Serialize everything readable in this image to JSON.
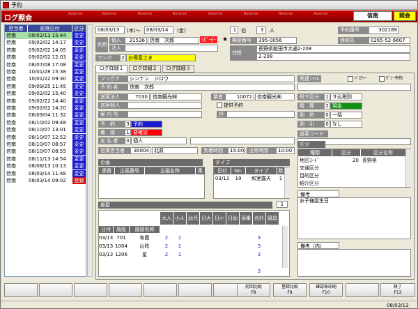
{
  "window": {
    "title": "予約"
  },
  "header": {
    "title": "ログ照会",
    "reserve": "Reserve",
    "right1": "信南",
    "right2": "照会"
  },
  "list": {
    "headers": [
      "担当者",
      "処理日付",
      "区分"
    ],
    "rows": [
      {
        "tanto": "信南",
        "date": "09/02/13 15:44",
        "kubun": "変更",
        "color": "#1a1ad0",
        "sel": true
      },
      {
        "tanto": "信南",
        "date": "09/02/02 14:17",
        "kubun": "変更",
        "color": "#1a1ad0"
      },
      {
        "tanto": "信南",
        "date": "09/02/02 14:05",
        "kubun": "変更",
        "color": "#1a1ad0"
      },
      {
        "tanto": "信南",
        "date": "09/02/02 12:03",
        "kubun": "変更",
        "color": "#1a1ad0"
      },
      {
        "tanto": "信南",
        "date": "08/07/08 17:08",
        "kubun": "変更",
        "color": "#1a1ad0"
      },
      {
        "tanto": "信南",
        "date": "10/01/28 15:38",
        "kubun": "変更",
        "color": "#1a1ad0"
      },
      {
        "tanto": "信南",
        "date": "10/01/22 09:30",
        "kubun": "変更",
        "color": "#1a1ad0"
      },
      {
        "tanto": "信南",
        "date": "09/09/25 11:45",
        "kubun": "変更",
        "color": "#1a1ad0"
      },
      {
        "tanto": "信南",
        "date": "09/02/02 15:40",
        "kubun": "変更",
        "color": "#1a1ad0"
      },
      {
        "tanto": "信南",
        "date": "09/02/22 14:40",
        "kubun": "変更",
        "color": "#1a1ad0"
      },
      {
        "tanto": "信南",
        "date": "09/02/02 14:20",
        "kubun": "変更",
        "color": "#1a1ad0"
      },
      {
        "tanto": "信南",
        "date": "08/09/04 11:32",
        "kubun": "変更",
        "color": "#1a1ad0"
      },
      {
        "tanto": "信南",
        "date": "08/10/02 09:48",
        "kubun": "変更",
        "color": "#1a1ad0"
      },
      {
        "tanto": "信南",
        "date": "08/10/07 13:01",
        "kubun": "変更",
        "color": "#1a1ad0"
      },
      {
        "tanto": "信南",
        "date": "08/10/07 12:52",
        "kubun": "変更",
        "color": "#1a1ad0"
      },
      {
        "tanto": "信南",
        "date": "08/10/07 08:57",
        "kubun": "変更",
        "color": "#1a1ad0"
      },
      {
        "tanto": "信南",
        "date": "08/10/07 08:55",
        "kubun": "変更",
        "color": "#1a1ad0"
      },
      {
        "tanto": "信南",
        "date": "08/11/13 14:54",
        "kubun": "変更",
        "color": "#1a1ad0"
      },
      {
        "tanto": "信南",
        "date": "08/08/13 10:13",
        "kubun": "変更",
        "color": "#1a1ad0"
      },
      {
        "tanto": "信南",
        "date": "08/03/14 11:48",
        "kubun": "変更",
        "color": "#1a1ad0"
      },
      {
        "tanto": "信南",
        "date": "08/03/14 09:02",
        "kubun": "登録",
        "color": "#d01010"
      }
    ]
  },
  "top": {
    "date_from": "08/03/13",
    "dow_from": "(木)～",
    "date_to": "08/03/14",
    "dow_to": "(金)",
    "haku": "1",
    "haku_lbl": "泊",
    "nin": "3",
    "nin_lbl": "人",
    "yoyaku_lbl": "予約番号",
    "yoyaku": "302189",
    "riyo": "利用",
    "kojin": "個人",
    "kojin_no": "31536",
    "kojin_name": "信南　次郎",
    "repeater": "ﾘﾋﾟｰﾀｰ",
    "hojin": "法人",
    "yubin_lbl": "郵便番号",
    "yubin": "395-0056",
    "renraku_lbl": "連絡先",
    "renraku": "0265-52-6607",
    "jusho_lbl": "住所",
    "jusho1": "長野県飯田市大通2-208",
    "jusho2": "2-208",
    "rank_lbl": "ランク",
    "rank_no": "2",
    "rank": "お得意さま"
  },
  "tabs": [
    "ログ詳細１",
    "ログ詳細２",
    "ログ詳細３"
  ],
  "form": {
    "furigana_lbl": "フリガナ",
    "furigana": "シンナン　ジロウ",
    "yoyakumei_lbl": "予 約 名",
    "yoyakumei": "信南　次郎",
    "okuri_hojin_lbl": "送客法人",
    "okuri_hojin_no": "7030",
    "okuri_hojin": "信南観光㈱",
    "gyosha_lbl": "業者",
    "gyosha_no": "10072",
    "gyosha": "信南観光㈱",
    "okuri_kojin_lbl": "送客個人",
    "teikei": "提供予約",
    "annai_lbl": "案 内 所",
    "tan_lbl": "担",
    "yoyaku_lbl": "予　約",
    "yoyaku_no": "3",
    "yoyaku": "予約",
    "kakunin_lbl": "確　認",
    "kakunin_no": "1",
    "kakunin": "要確認",
    "shiharai_lbl": "支 払 者",
    "shiharai_no": "0",
    "shiharai": "個人",
    "eigyo_lbl": "営業担当者",
    "eigyo_no": "30004",
    "eigyo": "北原",
    "totyaku_lbl": "到着時間",
    "totyaku": "15:00",
    "shuppatsu_lbl": "出発時間",
    "shuppatsu": "10:00"
  },
  "right": {
    "kanren_lbl": "関連ﾌｧｲﾙ",
    "bus": "ﾊﾞｽﾁｬｰ",
    "dummy": "ﾀﾞﾐｰ予約",
    "zei_lbl": "税サ区分",
    "zei_no": "1",
    "zei": "サ込税別",
    "seisan_lbl": "精　算",
    "seisan_no": "2",
    "seisan": "現金",
    "warifu_lbl": "割　符",
    "warifu_no": "0",
    "warifu": "一括",
    "waribiki_lbl": "割　引",
    "waribiki_no": "0",
    "waribiki": "なし",
    "soukyaku_lbl": "送客コード",
    "kubun_lbl": "区分",
    "kubun_heads": [
      "種類",
      "区分",
      "区分名称"
    ],
    "kubun_rows": [
      [
        "地区ｺｰﾄﾞ",
        "20",
        "長野県"
      ],
      [
        "交通区分",
        "",
        ""
      ],
      [
        "目的区分",
        "",
        ""
      ],
      [
        "紹介区分",
        "",
        ""
      ]
    ],
    "biko_lbl": "備考",
    "biko": "お子様誕生日",
    "biko_nai_lbl": "備考（内）"
  },
  "kikaku": {
    "lbl": "企画",
    "heads": [
      "連番",
      "企画番号",
      "企画名称",
      "集"
    ]
  },
  "type": {
    "lbl": "タイプ",
    "heads": [
      "日付",
      "No.",
      "タイプ",
      "数"
    ],
    "rows": [
      [
        "03/13",
        "19",
        "和室露天",
        "1"
      ]
    ]
  },
  "heya": {
    "lbl": "部屋",
    "count": "1",
    "heads": [
      "大人",
      "小人",
      "幼児",
      "日大",
      "日小",
      "日幼",
      "添乗",
      "合計",
      "寝具"
    ],
    "heads2": [
      "日付",
      "施設",
      "施設名称"
    ],
    "rows": [
      [
        "03/13",
        "701",
        "和霞",
        "2",
        "1",
        "3"
      ],
      [
        "03/13",
        "1004",
        "山吹",
        "2",
        "1",
        "3"
      ],
      [
        "03/13",
        "1206",
        "星",
        "2",
        "1",
        "3"
      ]
    ],
    "total": "3"
  },
  "buttons": [
    "前回比較\nF8",
    "登録比較\nF9",
    "確認表印刷\nF10",
    "終了\nF12"
  ],
  "status": {
    "date": "08/03/13"
  }
}
